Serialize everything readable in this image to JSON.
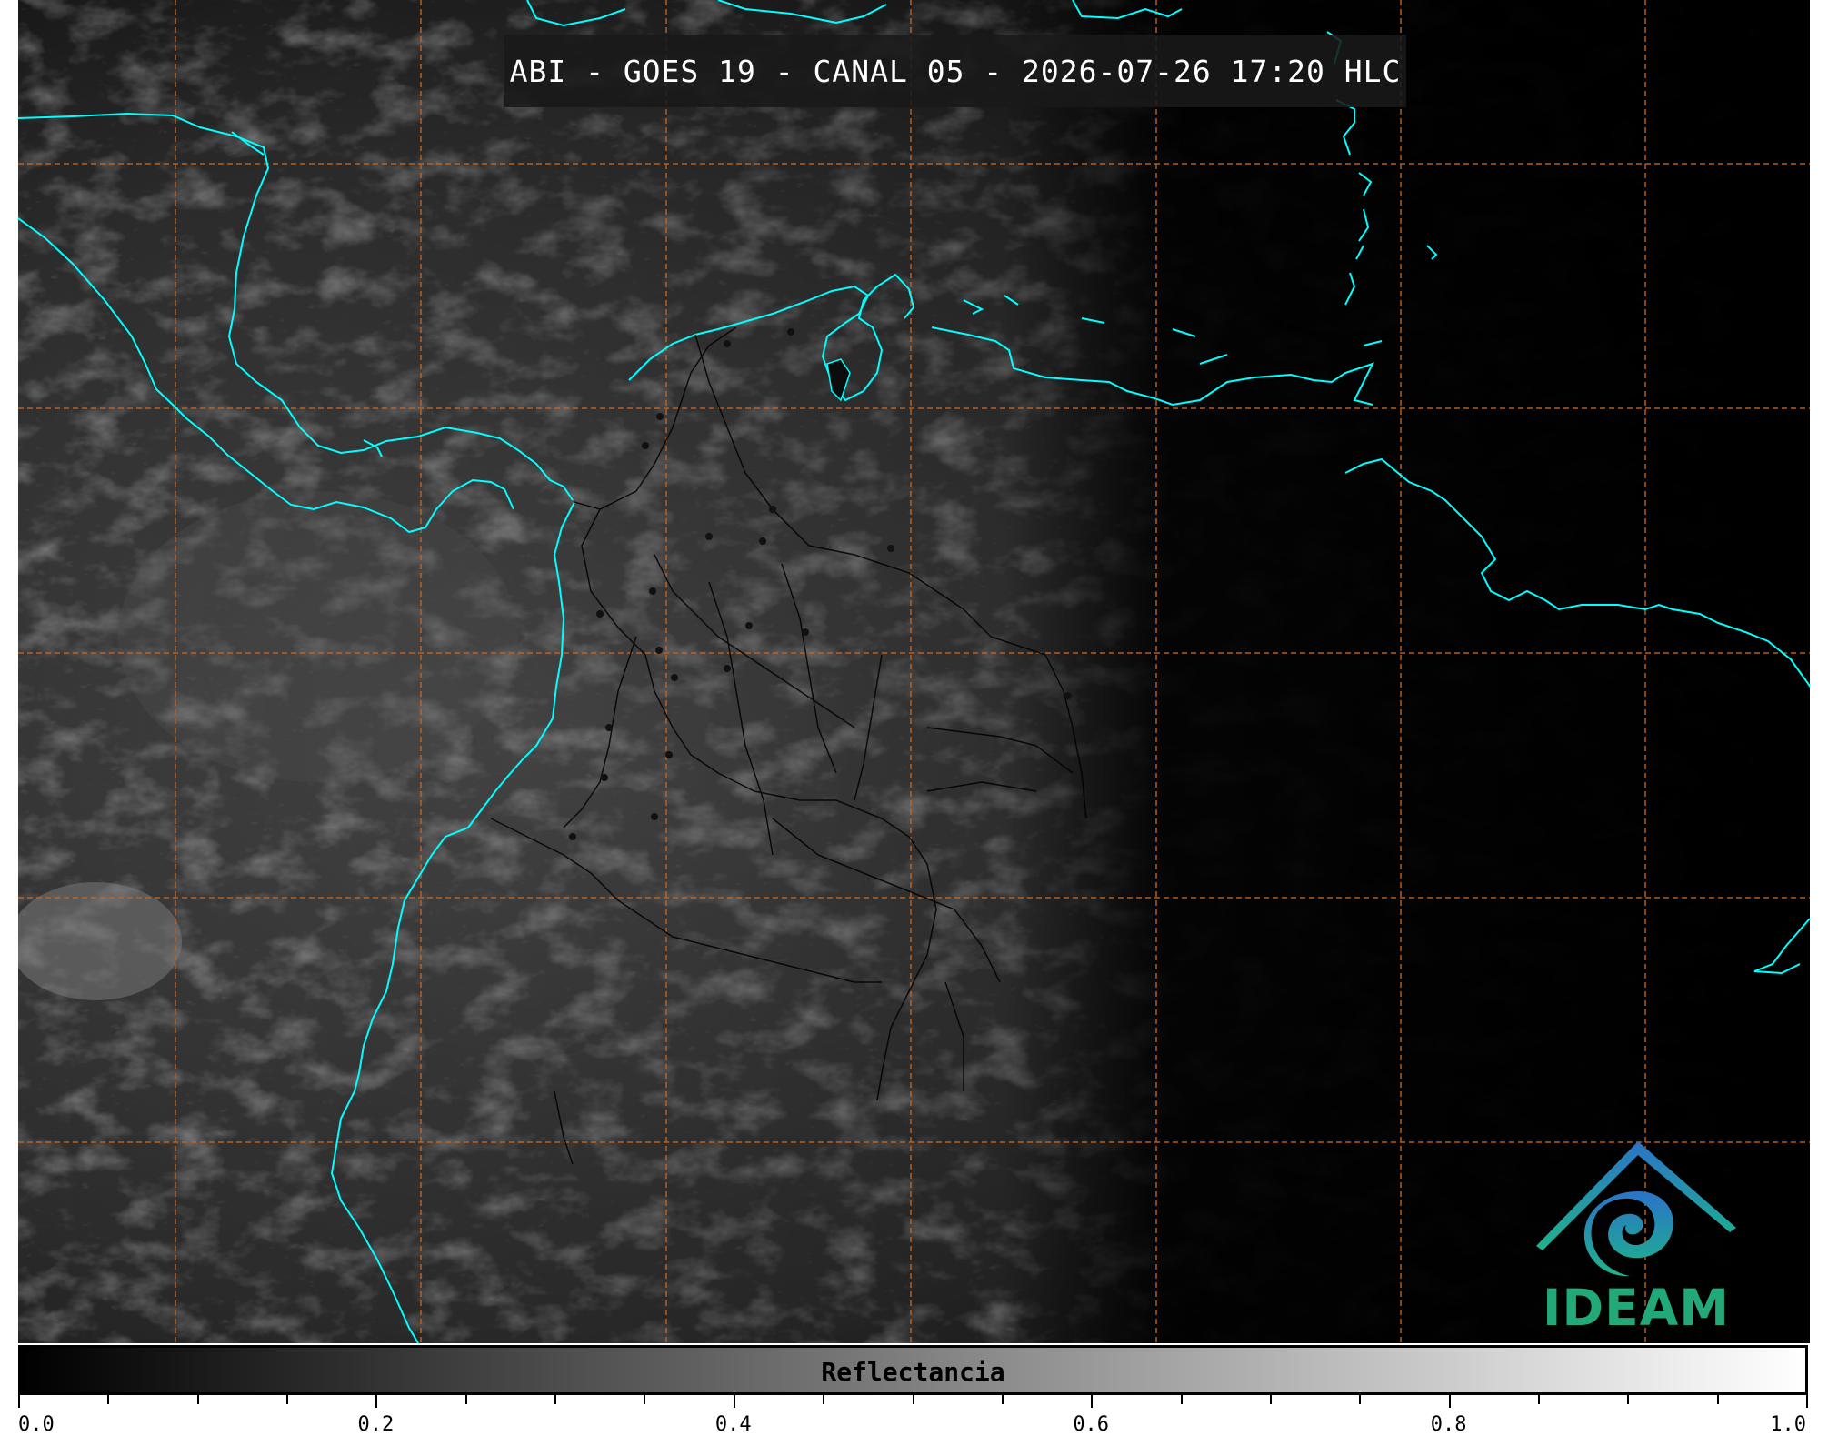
{
  "title": "ABI - GOES 19 - CANAL 05 - 2026-07-26 17:20 HLC",
  "logo": {
    "text": "IDEAM",
    "icon": "ideam-logo-icon",
    "color": "#23a878"
  },
  "colorbar": {
    "label": "Reflectancia",
    "min": 0.0,
    "max": 1.0,
    "tick_labels": [
      "0.0",
      "0.2",
      "0.4",
      "0.6",
      "0.8",
      "1.0"
    ],
    "minor_step": 0.05,
    "colors": [
      "#000000",
      "#ffffff"
    ]
  },
  "map": {
    "coastline_color": "#00ffff",
    "grid_color": "#c8661e",
    "border_color": "#000000"
  }
}
